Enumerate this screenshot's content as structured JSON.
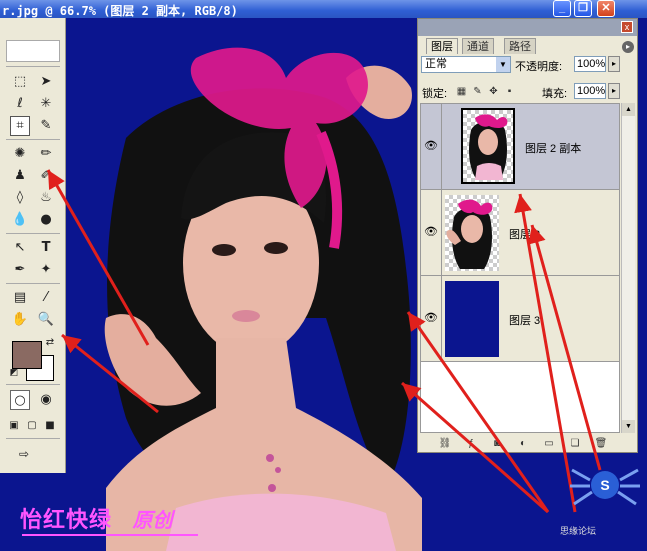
{
  "window": {
    "title": "r.jpg @ 66.7% (图层 2 副本, RGB/8)",
    "minimize": "_",
    "restore": "❐",
    "close": "✕"
  },
  "toolbox": {
    "tools": [
      "marquee",
      "move",
      "lasso",
      "magic-wand",
      "crop",
      "slice",
      "healing-brush",
      "brush",
      "clone-stamp",
      "history-brush",
      "eraser",
      "paint-bucket",
      "blur",
      "dodge",
      "path-select",
      "type",
      "pen",
      "shape",
      "notes",
      "eyedropper",
      "hand",
      "zoom"
    ],
    "fg_color": "#8a6a62",
    "bg_color": "#ffffff"
  },
  "layers_panel": {
    "tabs": [
      "图层",
      "通道",
      "路径"
    ],
    "active_tab": "图层",
    "blend_mode": "正常",
    "opacity_label": "不透明度:",
    "opacity_value": "100%",
    "lock_label": "锁定:",
    "fill_label": "填充:",
    "fill_value": "100%",
    "layers": [
      {
        "name": "图层 2 副本",
        "selected": true,
        "visible": true
      },
      {
        "name": "图层 2",
        "selected": false,
        "visible": true
      },
      {
        "name": "图层 3",
        "selected": false,
        "visible": true
      }
    ]
  },
  "watermark": {
    "main": "怡红快绿",
    "sub": "原创",
    "corner": "思缘论坛"
  },
  "colors": {
    "canvas_bg": "#0b158f",
    "arrow": "#e0201c",
    "watermark": "#ff55ff",
    "bow": "#e0198c"
  }
}
